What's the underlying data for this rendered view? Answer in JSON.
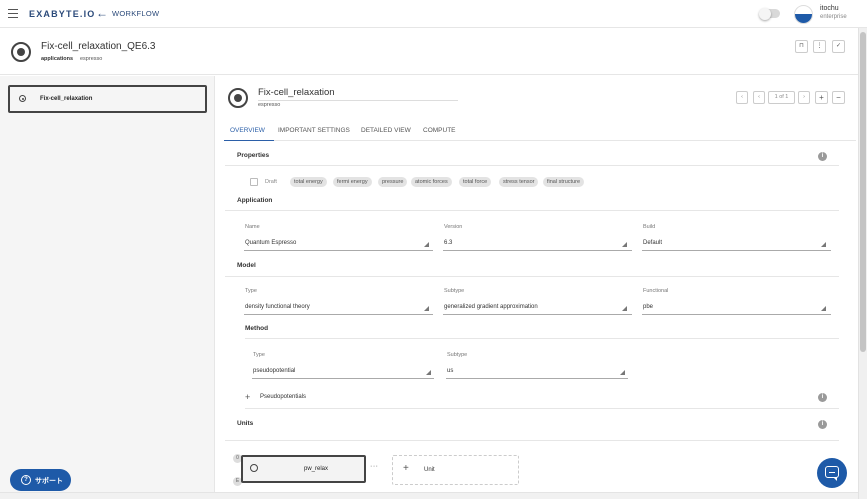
{
  "header": {
    "logo": "EXABYTE.IO",
    "section": "WORKFLOW",
    "user": {
      "name": "itochu",
      "account": "enterprise"
    }
  },
  "workflow": {
    "title": "Fix-cell_relaxation_QE6.3",
    "sub_label": "applications",
    "sub_value": "espresso",
    "buttons": [
      "⊓",
      "⋮",
      "✓"
    ]
  },
  "sidebar": {
    "items": [
      {
        "label": "Fix-cell_relaxation"
      }
    ]
  },
  "subworkflow": {
    "title": "Fix-cell_relaxation",
    "subtitle": "espresso",
    "pager": {
      "first": "‹",
      "prev": "‹",
      "page": "1 of 1",
      "next": "›",
      "add": "+",
      "remove": "−"
    }
  },
  "tabs": [
    {
      "label": "OVERVIEW",
      "active": true
    },
    {
      "label": "IMPORTANT SETTINGS",
      "active": false
    },
    {
      "label": "DETAILED VIEW",
      "active": false
    },
    {
      "label": "COMPUTE",
      "active": false
    }
  ],
  "properties": {
    "label": "Properties",
    "draft_label": "Draft",
    "chips": [
      "total energy",
      "fermi energy",
      "pressure",
      "atomic forces",
      "total force",
      "stress tensor",
      "final structure"
    ]
  },
  "application": {
    "label": "Application",
    "name": {
      "label": "Name",
      "value": "Quantum Espresso"
    },
    "version": {
      "label": "Version",
      "value": "6.3"
    },
    "build": {
      "label": "Build",
      "value": "Default"
    }
  },
  "model": {
    "label": "Model",
    "type": {
      "label": "Type",
      "value": "density functional theory"
    },
    "subtype": {
      "label": "Subtype",
      "value": "generalized gradient approximation"
    },
    "functional": {
      "label": "Functional",
      "value": "pbe"
    }
  },
  "method": {
    "label": "Method",
    "type": {
      "label": "Type",
      "value": "pseudopotential"
    },
    "subtype": {
      "label": "Subtype",
      "value": "us"
    },
    "pseudopotentials_label": "Pseudopotentials"
  },
  "units": {
    "label": "Units",
    "items": [
      {
        "label": "pw_relax"
      }
    ],
    "more": "···",
    "add_label": "Unit",
    "markers": [
      "0",
      "E"
    ]
  },
  "support": {
    "label": "サポート",
    "icon": "?"
  },
  "colors": {
    "accent": "#2b5fa8",
    "support": "#1e5aa8"
  }
}
